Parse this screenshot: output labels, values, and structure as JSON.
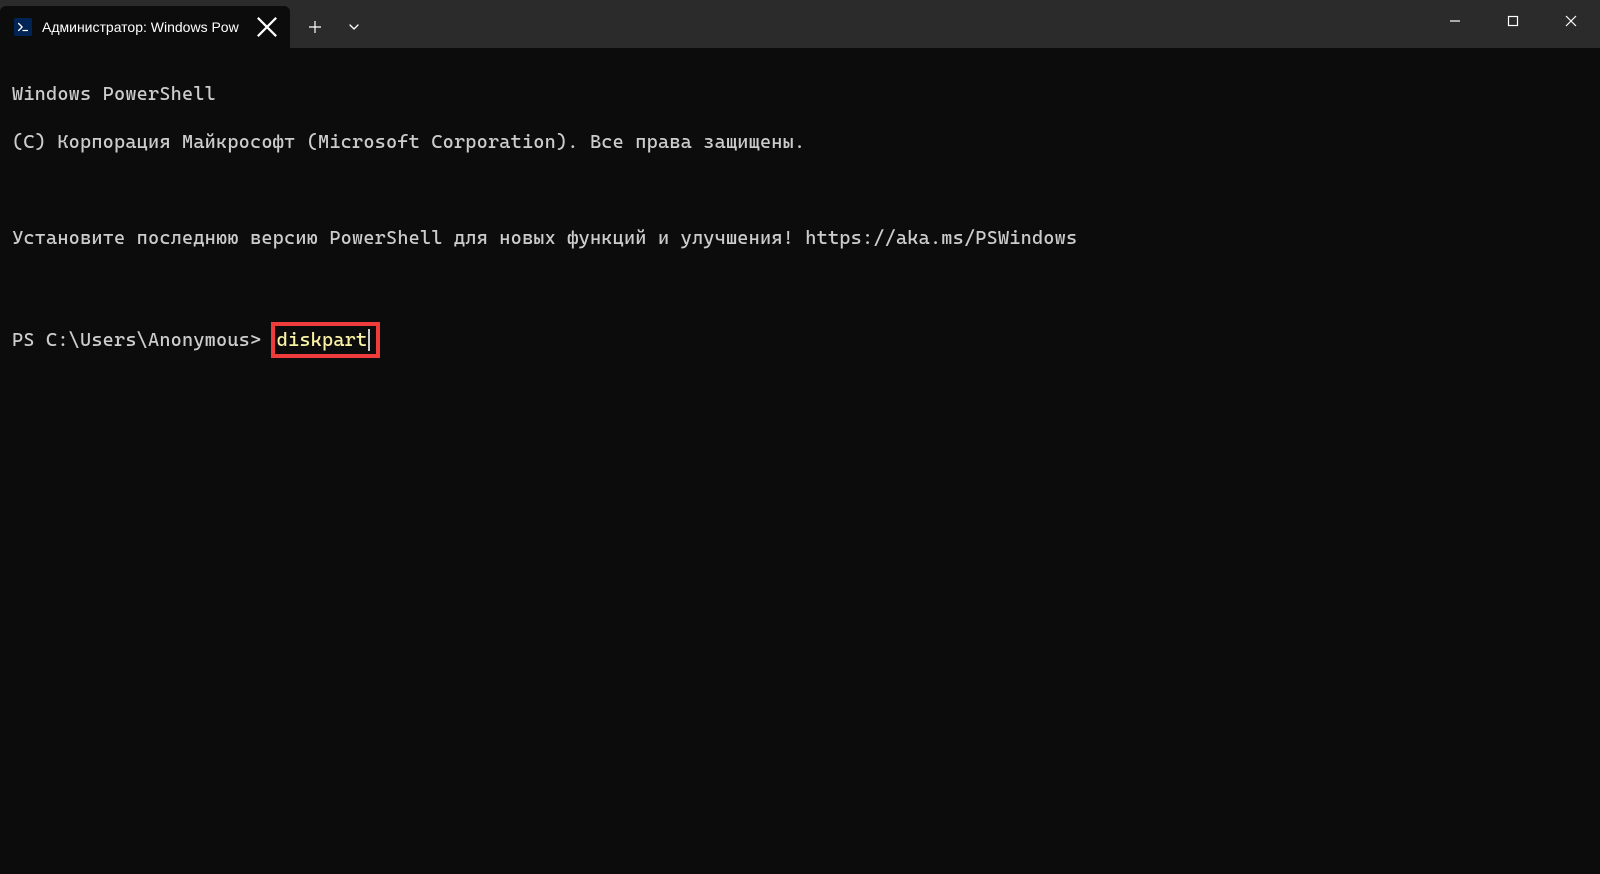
{
  "titlebar": {
    "tab": {
      "title": "Администратор: Windows Pow",
      "icon_name": "powershell"
    }
  },
  "terminal": {
    "line1": "Windows PowerShell",
    "line2": "(C) Корпорация Майкрософт (Microsoft Corporation). Все права защищены.",
    "line3": "Установите последнюю версию PowerShell для новых функций и улучшения! https://aka.ms/PSWindows",
    "prompt": "PS C:\\Users\\Anonymous> ",
    "command": "diskpart"
  },
  "colors": {
    "highlight_border": "#ee3b3b",
    "command_text": "#f9f1a5",
    "terminal_bg": "#0c0c0c",
    "titlebar_bg": "#2b2b2b"
  }
}
